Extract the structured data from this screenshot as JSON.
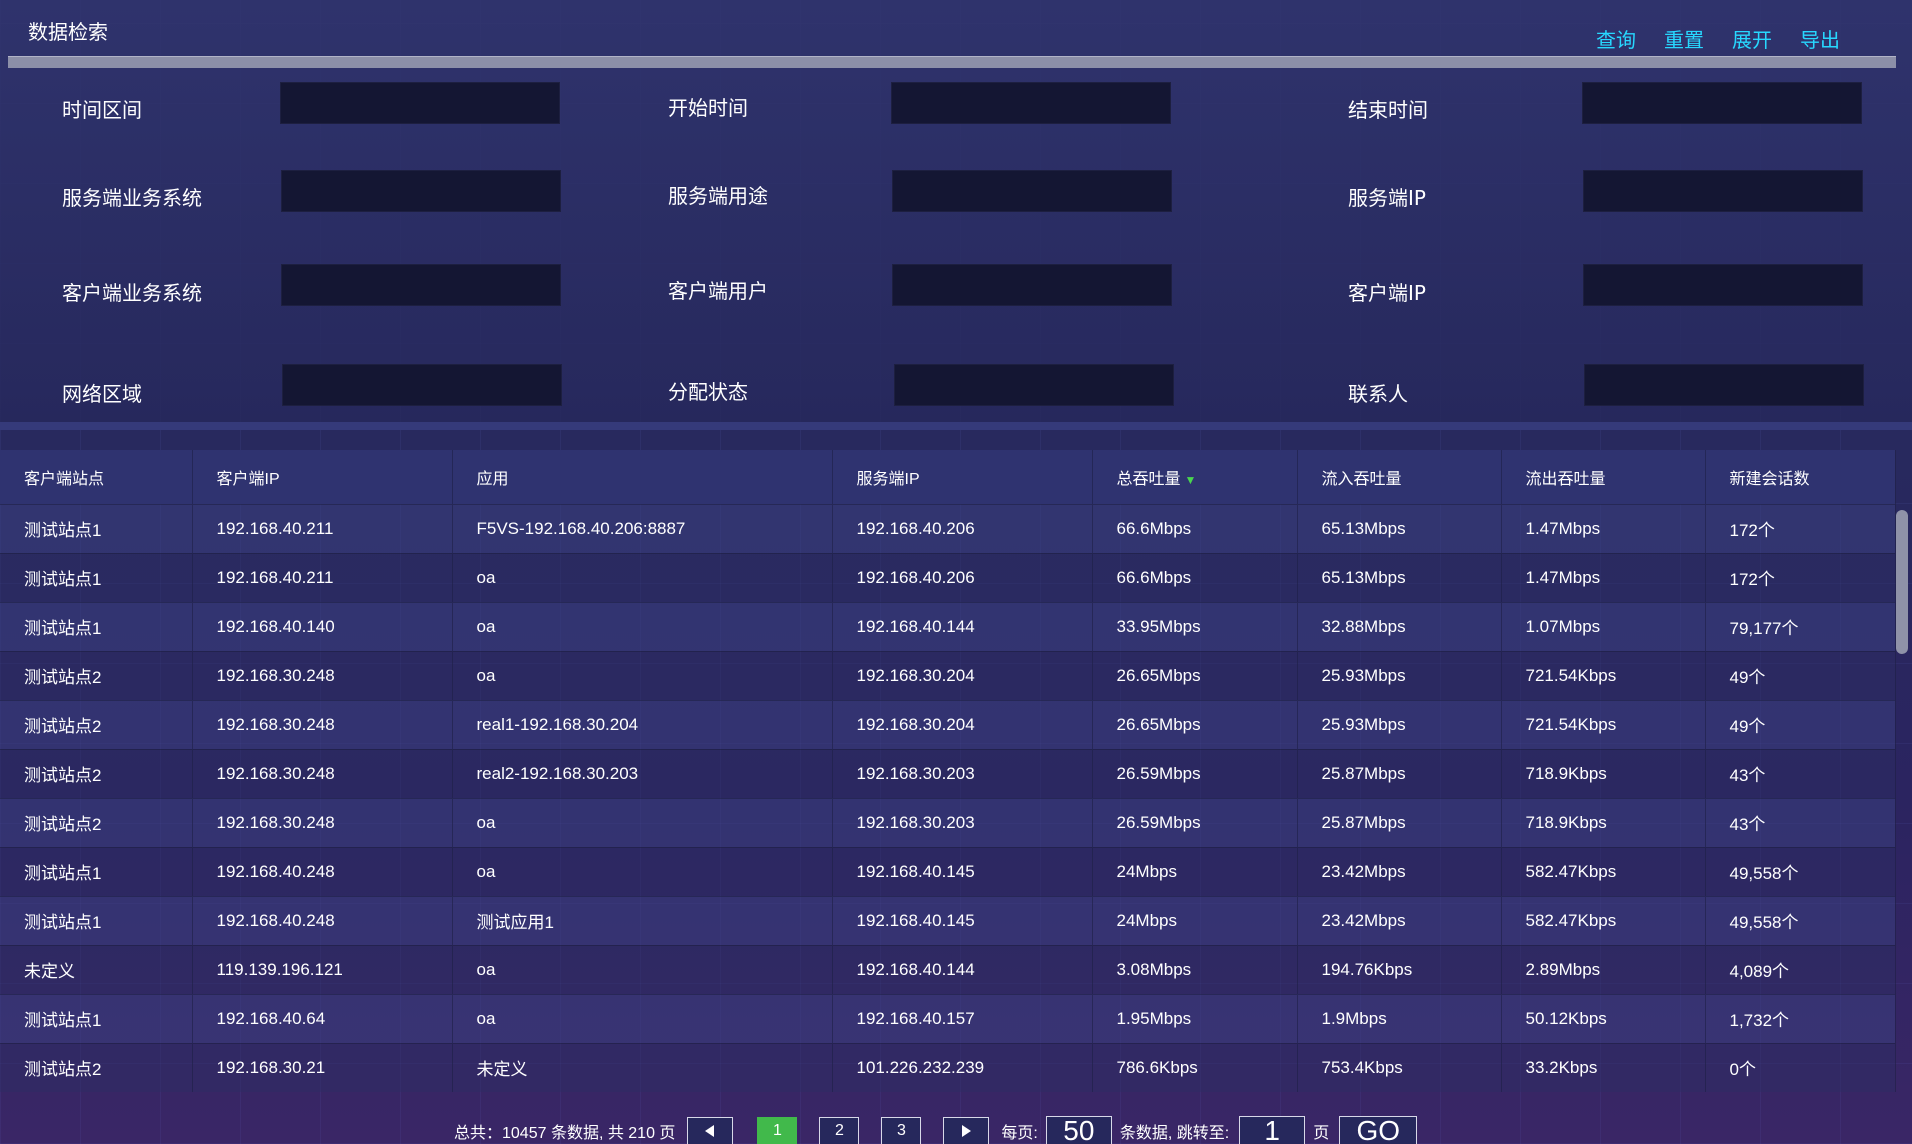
{
  "header": {
    "title": "数据检索",
    "actions": [
      "查询",
      "重置",
      "展开",
      "导出"
    ]
  },
  "filters": [
    {
      "label": "时间区间"
    },
    {
      "label": "开始时间"
    },
    {
      "label": "结束时间"
    },
    {
      "label": "服务端业务系统"
    },
    {
      "label": "服务端用途"
    },
    {
      "label": "服务端IP"
    },
    {
      "label": "客户端业务系统"
    },
    {
      "label": "客户端用户"
    },
    {
      "label": "客户端IP"
    },
    {
      "label": "网络区域"
    },
    {
      "label": "分配状态"
    },
    {
      "label": "联系人"
    }
  ],
  "table": {
    "columns": [
      "客户端站点",
      "客户端IP",
      "应用",
      "服务端IP",
      "总吞吐量",
      "流入吞吐量",
      "流出吞吐量",
      "新建会话数"
    ],
    "sorted_column": "总吞吐量",
    "rows": [
      [
        "测试站点1",
        "192.168.40.211",
        "F5VS-192.168.40.206:8887",
        "192.168.40.206",
        "66.6Mbps",
        "65.13Mbps",
        "1.47Mbps",
        "172个"
      ],
      [
        "测试站点1",
        "192.168.40.211",
        "oa",
        "192.168.40.206",
        "66.6Mbps",
        "65.13Mbps",
        "1.47Mbps",
        "172个"
      ],
      [
        "测试站点1",
        "192.168.40.140",
        "oa",
        "192.168.40.144",
        "33.95Mbps",
        "32.88Mbps",
        "1.07Mbps",
        "79,177个"
      ],
      [
        "测试站点2",
        "192.168.30.248",
        "oa",
        "192.168.30.204",
        "26.65Mbps",
        "25.93Mbps",
        "721.54Kbps",
        "49个"
      ],
      [
        "测试站点2",
        "192.168.30.248",
        "real1-192.168.30.204",
        "192.168.30.204",
        "26.65Mbps",
        "25.93Mbps",
        "721.54Kbps",
        "49个"
      ],
      [
        "测试站点2",
        "192.168.30.248",
        "real2-192.168.30.203",
        "192.168.30.203",
        "26.59Mbps",
        "25.87Mbps",
        "718.9Kbps",
        "43个"
      ],
      [
        "测试站点2",
        "192.168.30.248",
        "oa",
        "192.168.30.203",
        "26.59Mbps",
        "25.87Mbps",
        "718.9Kbps",
        "43个"
      ],
      [
        "测试站点1",
        "192.168.40.248",
        "oa",
        "192.168.40.145",
        "24Mbps",
        "23.42Mbps",
        "582.47Kbps",
        "49,558个"
      ],
      [
        "测试站点1",
        "192.168.40.248",
        "测试应用1",
        "192.168.40.145",
        "24Mbps",
        "23.42Mbps",
        "582.47Kbps",
        "49,558个"
      ],
      [
        "未定义",
        "119.139.196.121",
        "oa",
        "192.168.40.144",
        "3.08Mbps",
        "194.76Kbps",
        "2.89Mbps",
        "4,089个"
      ],
      [
        "测试站点1",
        "192.168.40.64",
        "oa",
        "192.168.40.157",
        "1.95Mbps",
        "1.9Mbps",
        "50.12Kbps",
        "1,732个"
      ],
      [
        "测试站点2",
        "192.168.30.21",
        "未定义",
        "101.226.232.239",
        "786.6Kbps",
        "753.4Kbps",
        "33.2Kbps",
        "0个"
      ]
    ]
  },
  "pagination": {
    "summary": "总共：10457 条数据, 共 210 页",
    "pages": [
      "1",
      "2",
      "3"
    ],
    "current_page": "1",
    "per_page_label": "每页:",
    "per_page_value": "50",
    "jump_label": "条数据, 跳转至:",
    "jump_value": "1",
    "page_unit": "页",
    "go_label": "GO"
  },
  "colors": {
    "accent": "#27d8ff",
    "active_page": "#41b94b",
    "sort_arrow": "#49d64e"
  },
  "icons": {
    "prev": "triangle-left-icon",
    "next": "triangle-right-icon",
    "sort": "sort-down-icon"
  }
}
